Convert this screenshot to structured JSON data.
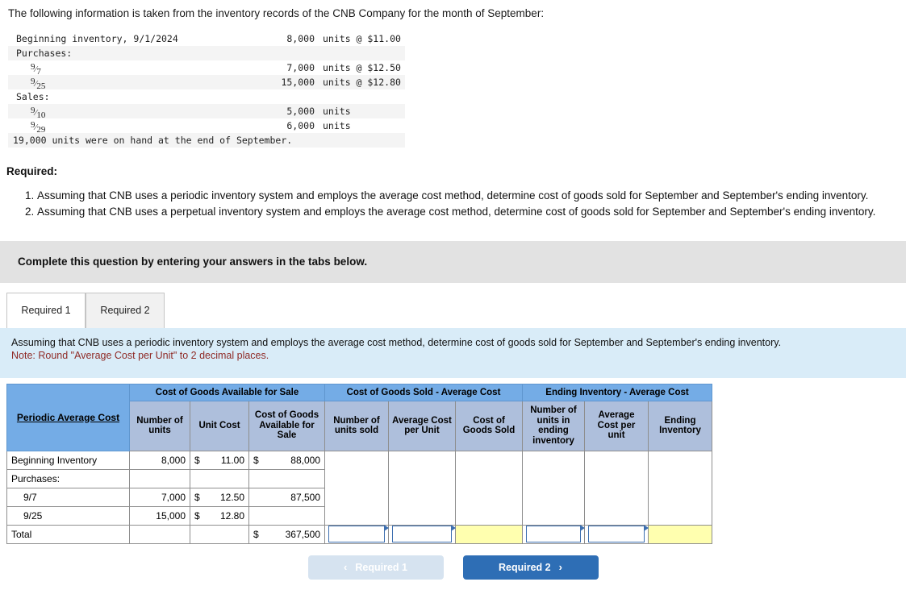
{
  "intro": "The following information is taken from the inventory records of the CNB Company for the month of September:",
  "data_block": {
    "rows": [
      {
        "label": "Beginning inventory, 9/1/2024",
        "indent": false,
        "fraction": null,
        "value": "8,000",
        "unit": "units @ $11.00",
        "shade": false
      },
      {
        "label": "Purchases:",
        "indent": false,
        "fraction": null,
        "value": "",
        "unit": "",
        "shade": true
      },
      {
        "label": "",
        "indent": true,
        "fraction": "9/7",
        "value": "7,000",
        "unit": "units @ $12.50",
        "shade": false
      },
      {
        "label": "",
        "indent": true,
        "fraction": "9/25",
        "value": "15,000",
        "unit": "units @ $12.80",
        "shade": true
      },
      {
        "label": "Sales:",
        "indent": false,
        "fraction": null,
        "value": "",
        "unit": "",
        "shade": false
      },
      {
        "label": "",
        "indent": true,
        "fraction": "9/10",
        "value": "5,000",
        "unit": "units",
        "shade": true
      },
      {
        "label": "",
        "indent": true,
        "fraction": "9/29",
        "value": "6,000",
        "unit": "units",
        "shade": false
      }
    ],
    "footnote": "19,000 units were on hand at the end of September."
  },
  "required": {
    "heading": "Required:",
    "items": [
      "Assuming that CNB uses a periodic inventory system and employs the average cost method, determine cost of goods sold for September and September's ending inventory.",
      "Assuming that CNB uses a perpetual inventory system and employs the average cost method, determine cost of goods sold for September and September's ending inventory."
    ]
  },
  "banner": "Complete this question by entering your answers in the tabs below.",
  "tabs": [
    {
      "label": "Required 1",
      "active": true
    },
    {
      "label": "Required 2",
      "active": false
    }
  ],
  "info_box": {
    "text": "Assuming that CNB uses a periodic inventory system and employs the average cost method, determine cost of goods sold for September and September's ending inventory.",
    "note": "Note: Round \"Average Cost per Unit\" to 2 decimal places."
  },
  "worksheet": {
    "corner_label": "Periodic Average Cost",
    "groups": [
      "Cost of Goods Available for Sale",
      "Cost of Goods Sold - Average Cost",
      "Ending Inventory - Average Cost"
    ],
    "subheaders": [
      "Number of units",
      "Unit Cost",
      "Cost of Goods Available for Sale",
      "Number of units sold",
      "Average Cost per Unit",
      "Cost of Goods Sold",
      "Number of units in ending inventory",
      "Average Cost per unit",
      "Ending Inventory"
    ],
    "rows": [
      {
        "label": "Beginning Inventory",
        "indent": false,
        "units": "8,000",
        "unit_cost_sym": "$",
        "unit_cost": "11.00",
        "cogafs_sym": "$",
        "cogafs": "88,000"
      },
      {
        "label": "Purchases:",
        "indent": false,
        "units": "",
        "unit_cost_sym": "",
        "unit_cost": "",
        "cogafs_sym": "",
        "cogafs": ""
      },
      {
        "label": "9/7",
        "indent": true,
        "units": "7,000",
        "unit_cost_sym": "$",
        "unit_cost": "12.50",
        "cogafs_sym": "",
        "cogafs": "87,500"
      },
      {
        "label": "9/25",
        "indent": true,
        "units": "15,000",
        "unit_cost_sym": "$",
        "unit_cost": "12.80",
        "cogafs_sym": "",
        "cogafs": ""
      }
    ],
    "total": {
      "label": "Total",
      "units": "",
      "unit_cost": "",
      "cogafs_sym": "$",
      "cogafs": "367,500",
      "units_sold": "",
      "avg_cost_unit": "",
      "cogs": "",
      "ending_units": "",
      "ending_avg_cost": "",
      "ending_inventory": ""
    }
  },
  "nav": {
    "prev_label": "Required 1",
    "next_label": "Required 2",
    "prev_icon": "chevron-left-icon",
    "next_icon": "chevron-right-icon"
  },
  "colors": {
    "group_header": "#74ace6",
    "sub_header": "#aebfdc",
    "info_box": "#d9ecf8",
    "banner": "#e2e2e2",
    "note_red": "#8f2a26",
    "input_border": "#3d6fb0",
    "yellow_cell": "#ffffaf",
    "next_button": "#2e6eb5",
    "prev_button": "#d6e3f0"
  }
}
